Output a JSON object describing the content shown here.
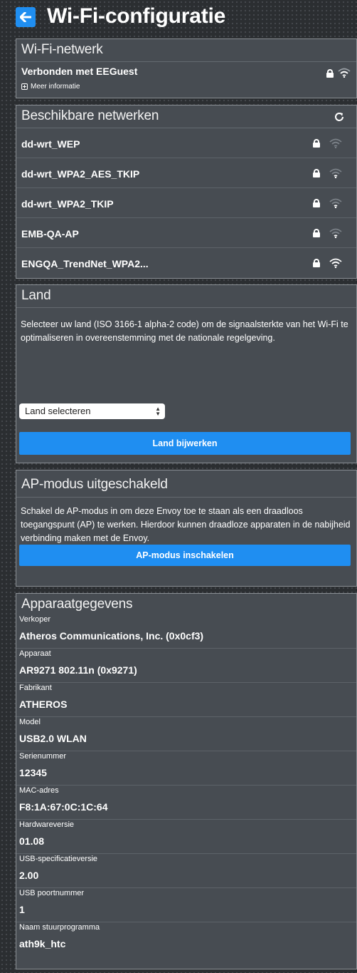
{
  "header": {
    "title": "Wi-Fi-configuratie",
    "back_icon": "arrow-left-icon"
  },
  "wifi_network": {
    "title": "Wi-Fi-netwerk",
    "connected_prefix": "Verbonden met ",
    "connected_ssid": "EEGuest",
    "more_info": "Meer informatie",
    "more_info_icon": "plus-square-icon"
  },
  "available": {
    "title": "Beschikbare netwerken",
    "refresh_icon": "refresh-icon",
    "networks": [
      {
        "ssid": "dd-wrt_WEP",
        "secured": true,
        "signal": 0
      },
      {
        "ssid": "dd-wrt_WPA2_AES_TKIP",
        "secured": true,
        "signal": 1
      },
      {
        "ssid": "dd-wrt_WPA2_TKIP",
        "secured": true,
        "signal": 1
      },
      {
        "ssid": "EMB-QA-AP",
        "secured": true,
        "signal": 1
      },
      {
        "ssid": "ENGQA_TrendNet_WPA2...",
        "secured": true,
        "signal": 3
      }
    ]
  },
  "country": {
    "title": "Land",
    "description": "Selecteer uw land (ISO 3166-1 alpha-2 code) om de signaalsterkte van het Wi-Fi te optimaliseren in overeenstemming met de nationale regelgeving.",
    "select_value": "Land selecteren",
    "button": "Land bijwerken"
  },
  "ap_mode": {
    "title": "AP-modus uitgeschakeld",
    "description": "Schakel de AP-modus in om deze Envoy toe te staan als een draadloos toegangspunt (AP) te werken. Hierdoor kunnen draadloze apparaten in de nabijheid verbinding maken met de Envoy.",
    "button": "AP-modus inschakelen"
  },
  "device": {
    "title": "Apparaatgegevens",
    "items": [
      {
        "label": "Verkoper",
        "value": "Atheros Communications, Inc. (0x0cf3)"
      },
      {
        "label": "Apparaat",
        "value": "AR9271 802.11n (0x9271)"
      },
      {
        "label": "Fabrikant",
        "value": "ATHEROS"
      },
      {
        "label": "Model",
        "value": "USB2.0 WLAN"
      },
      {
        "label": "Serienummer",
        "value": "12345"
      },
      {
        "label": "MAC-adres",
        "value": "F8:1A:67:0C:1C:64"
      },
      {
        "label": "Hardwareversie",
        "value": "01.08"
      },
      {
        "label": "USB-specificatieversie",
        "value": "2.00"
      },
      {
        "label": "USB poortnummer",
        "value": "1"
      },
      {
        "label": "Naam stuurprogramma",
        "value": "ath9k_htc"
      }
    ]
  },
  "colors": {
    "accent": "#1f8ef1",
    "panel": "#474c52",
    "background": "#2b2e31"
  }
}
